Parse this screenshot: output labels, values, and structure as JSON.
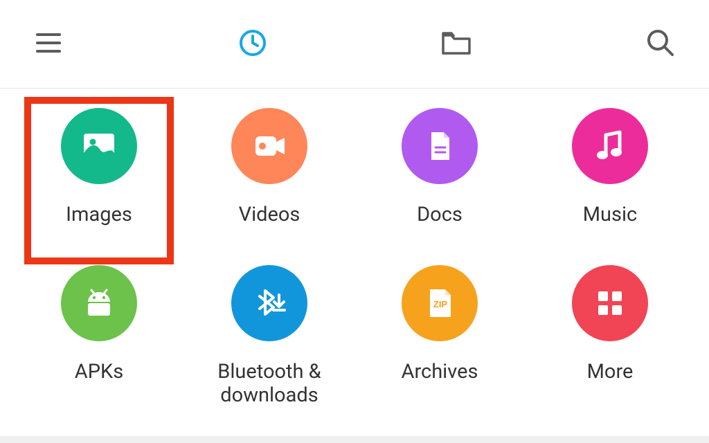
{
  "topbar": {
    "icons": {
      "menu": "menu-icon",
      "recent": "clock-icon",
      "folder": "folder-icon",
      "search": "search-icon"
    },
    "active_tab": "recent"
  },
  "categories": [
    {
      "id": "images",
      "label": "Images",
      "color": "#13b98a",
      "highlighted": true
    },
    {
      "id": "videos",
      "label": "Videos",
      "color": "#ff8658",
      "highlighted": false
    },
    {
      "id": "docs",
      "label": "Docs",
      "color": "#b05af0",
      "highlighted": false
    },
    {
      "id": "music",
      "label": "Music",
      "color": "#ed2c9b",
      "highlighted": false
    },
    {
      "id": "apks",
      "label": "APKs",
      "color": "#6cc24a",
      "highlighted": false
    },
    {
      "id": "bluetooth",
      "label": "Bluetooth & downloads",
      "color": "#1296db",
      "highlighted": false
    },
    {
      "id": "archives",
      "label": "Archives",
      "color": "#f6a21d",
      "highlighted": false
    },
    {
      "id": "more",
      "label": "More",
      "color": "#f14455",
      "highlighted": false
    }
  ]
}
